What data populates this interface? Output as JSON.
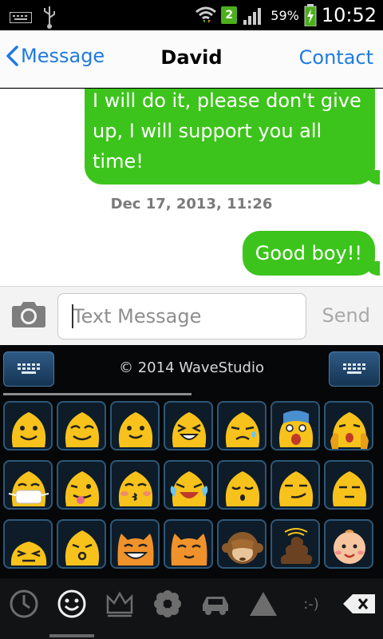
{
  "status_bar": {
    "notification_badge": "2",
    "battery_percent": "59%",
    "time": "10:52",
    "icons": [
      "keyboard-icon",
      "usb-icon",
      "wifi-icon",
      "signal-icon",
      "battery-charging-icon"
    ]
  },
  "nav": {
    "back_label": "Message",
    "title": "David",
    "contact_label": "Contact"
  },
  "conversation": {
    "messages": [
      {
        "from": "me",
        "text": "I will do it, please don't give up, I will support you all time!"
      },
      {
        "from": "me",
        "text": "Good boy!!"
      }
    ],
    "timestamp": "Dec 17, 2013, 11:26"
  },
  "compose": {
    "placeholder": "Text Message",
    "send_label": "Send"
  },
  "keyboard": {
    "credit": "© 2014 WaveStudio",
    "emoji_rows": [
      [
        "smile",
        "grin",
        "happy",
        "laugh",
        "sad",
        "scream",
        "shocked"
      ],
      [
        "mask",
        "tongue",
        "kiss",
        "cry-laugh",
        "calm",
        "smirk",
        "sleepy"
      ],
      [
        "squint",
        "whistle",
        "cat-grin",
        "cat",
        "see-no-evil-monkey",
        "poop",
        "baby"
      ]
    ],
    "categories": [
      "recent",
      "smiley",
      "crown",
      "flower",
      "car",
      "triangle",
      ":-)",
      "backspace"
    ],
    "active_category": "smiley",
    "colors": {
      "accent_green": "#3dc41c",
      "link_blue": "#1f7be0",
      "emoji_yellow": "#f7c21b"
    }
  }
}
